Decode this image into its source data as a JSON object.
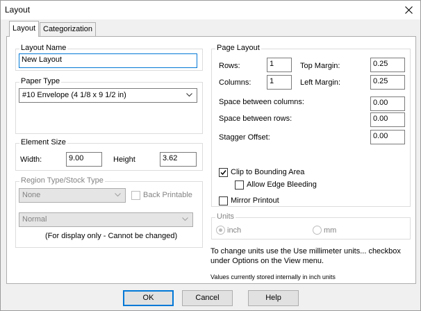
{
  "window": {
    "title": "Layout"
  },
  "tabs": [
    {
      "label": "Layout",
      "active": true
    },
    {
      "label": "Categorization",
      "active": false
    }
  ],
  "layout_name": {
    "legend": "Layout Name",
    "value": "New Layout"
  },
  "paper_type": {
    "legend": "Paper Type",
    "selected": "#10 Envelope (4 1/8 x 9 1/2 in)"
  },
  "element_size": {
    "legend": "Element Size",
    "width_label": "Width:",
    "width_value": "9.00",
    "height_label": "Height",
    "height_value": "3.62"
  },
  "region_type": {
    "legend": "Region Type/Stock Type",
    "region_selected": "None",
    "back_printable_label": "Back Printable",
    "stock_selected": "Normal",
    "note": "(For display only - Cannot be changed)"
  },
  "page_layout": {
    "legend": "Page Layout",
    "rows_label": "Rows:",
    "rows_value": "1",
    "columns_label": "Columns:",
    "columns_value": "1",
    "top_margin_label": "Top Margin:",
    "top_margin_value": "0.25",
    "left_margin_label": "Left Margin:",
    "left_margin_value": "0.25",
    "space_columns_label": "Space between columns:",
    "space_columns_value": "0.00",
    "space_rows_label": "Space between rows:",
    "space_rows_value": "0.00",
    "stagger_label": "Stagger Offset:",
    "stagger_value": "0.00",
    "clip_label": "Clip to Bounding Area",
    "clip_checked": true,
    "bleed_label": "Allow Edge Bleeding",
    "bleed_checked": false,
    "mirror_label": "Mirror Printout",
    "mirror_checked": false
  },
  "units": {
    "legend": "Units",
    "inch_label": "inch",
    "mm_label": "mm",
    "selected": "inch",
    "help_text": "To change units use the Use millimeter units... checkbox under Options on the View menu.",
    "stored_text": "Values currently stored internally in inch units"
  },
  "buttons": {
    "ok": "OK",
    "cancel": "Cancel",
    "help": "Help"
  },
  "icons": {
    "close": "close-icon",
    "dropdown": "chevron-down-icon",
    "check": "check-icon"
  }
}
